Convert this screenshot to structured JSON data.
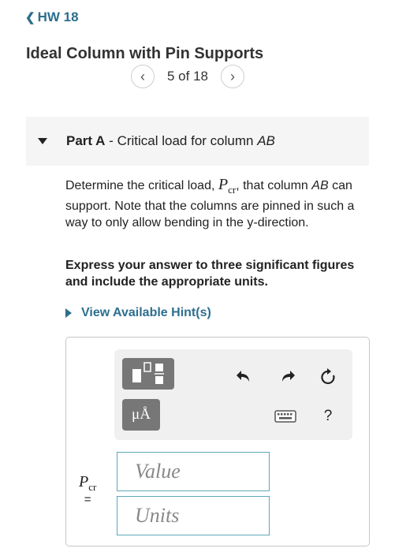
{
  "nav": {
    "back_label": "HW 18"
  },
  "problem": {
    "title": "Ideal Column with Pin Supports"
  },
  "pager": {
    "text": "5 of 18"
  },
  "part": {
    "label": "Part A",
    "separator": " - ",
    "desc_pre": "Critical load for column ",
    "desc_em": "AB"
  },
  "question": {
    "s1": "Determine the critical load,",
    "s2": ", that column",
    "s3": "AB",
    "s4": "can support. Note that the columns are pinned in such a way to only allow bending in the y-direction.",
    "express": "Express your answer to three significant figures and include the appropriate units."
  },
  "hint": {
    "label": "View Available Hint(s)"
  },
  "symbol": {
    "var": "P",
    "sub": "cr",
    "eq": "="
  },
  "toolbar": {
    "units_button": "μÅ",
    "help": "?"
  },
  "inputs": {
    "value_placeholder": "Value",
    "units_placeholder": "Units"
  },
  "colors": {
    "accent": "#2d6f8f",
    "field_border": "#5ca8b8",
    "toolbar_button": "#777777"
  }
}
